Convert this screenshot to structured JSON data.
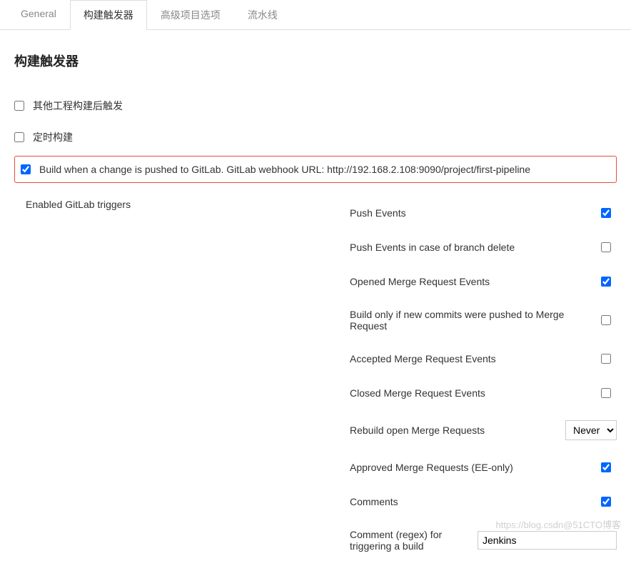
{
  "tabs": {
    "general": "General",
    "buildTriggers": "构建触发器",
    "advancedOptions": "高级项目选项",
    "pipeline": "流水线"
  },
  "section": {
    "title": "构建触发器"
  },
  "checkboxes": {
    "otherProject": "其他工程构建后触发",
    "scheduled": "定时构建",
    "gitlabPush": "Build when a change is pushed to GitLab. GitLab webhook URL: http://192.168.2.108:9090/project/first-pipeline"
  },
  "triggers": {
    "sectionLabel": "Enabled GitLab triggers",
    "options": {
      "pushEvents": {
        "label": "Push Events",
        "checked": true
      },
      "pushEventsDelete": {
        "label": "Push Events in case of branch delete",
        "checked": false
      },
      "openedMR": {
        "label": "Opened Merge Request Events",
        "checked": true
      },
      "buildOnlyNewCommits": {
        "label": "Build only if new commits were pushed to Merge Request",
        "checked": false
      },
      "acceptedMR": {
        "label": "Accepted Merge Request Events",
        "checked": false
      },
      "closedMR": {
        "label": "Closed Merge Request Events",
        "checked": false
      },
      "rebuildOpenMR": {
        "label": "Rebuild open Merge Requests",
        "select": "Never"
      },
      "approvedMR": {
        "label": "Approved Merge Requests (EE-only)",
        "checked": true
      },
      "comments": {
        "label": "Comments",
        "checked": true
      },
      "commentRegex": {
        "label": "Comment (regex) for triggering a build",
        "value": "Jenkins"
      }
    }
  },
  "watermark": "https://blog.csdn@51CTO博客"
}
